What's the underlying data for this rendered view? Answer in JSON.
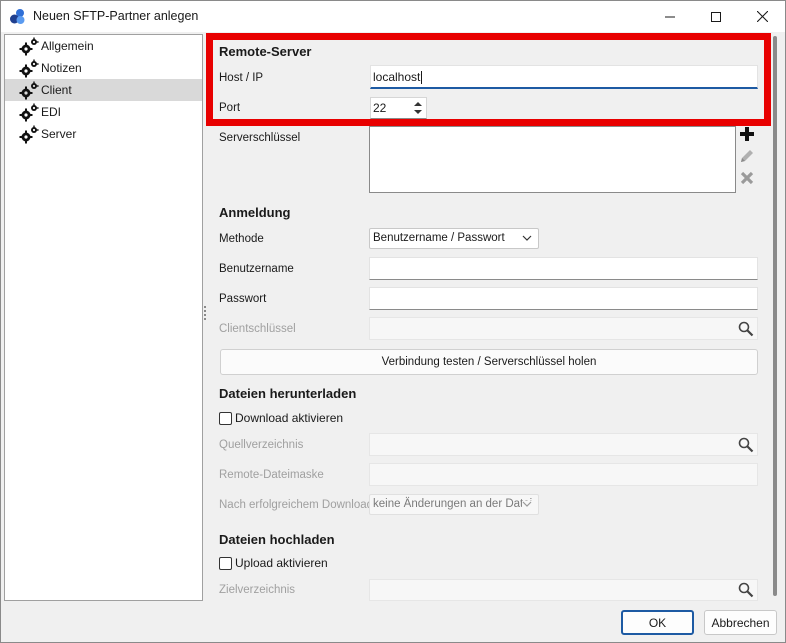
{
  "window": {
    "title": "Neuen SFTP-Partner anlegen",
    "accent_color": "#1d5aa3",
    "highlight_color": "#e80000"
  },
  "sidebar": {
    "items": [
      {
        "label": "Allgemein",
        "icon": "gears-icon",
        "selected": false
      },
      {
        "label": "Notizen",
        "icon": "gears-icon",
        "selected": false
      },
      {
        "label": "Client",
        "icon": "gears-icon",
        "selected": true
      },
      {
        "label": "EDI",
        "icon": "gears-icon",
        "selected": false
      },
      {
        "label": "Server",
        "icon": "gears-icon",
        "selected": false
      }
    ]
  },
  "remote_server": {
    "section_title": "Remote-Server",
    "host_label": "Host / IP",
    "host_value": "localhost",
    "port_label": "Port",
    "port_value": "22",
    "server_key_label": "Serverschlüssel"
  },
  "login": {
    "section_title": "Anmeldung",
    "method_label": "Methode",
    "method_value": "Benutzername / Passwort",
    "username_label": "Benutzername",
    "username_value": "",
    "password_label": "Passwort",
    "password_value": "",
    "client_key_label": "Clientschlüssel",
    "client_key_value": "",
    "test_button_label": "Verbindung testen / Serverschlüssel holen"
  },
  "download": {
    "section_title": "Dateien herunterladen",
    "enable_label": "Download aktivieren",
    "enabled": false,
    "source_dir_label": "Quellverzeichnis",
    "remote_mask_label": "Remote-Dateimaske",
    "after_download_label": "Nach erfolgreichem Download...",
    "after_download_value": "keine Änderungen an der Datei"
  },
  "upload": {
    "section_title": "Dateien hochladen",
    "enable_label": "Upload aktivieren",
    "enabled": false,
    "target_dir_label": "Zielverzeichnis"
  },
  "footer": {
    "ok_label": "OK",
    "cancel_label": "Abbrechen"
  }
}
